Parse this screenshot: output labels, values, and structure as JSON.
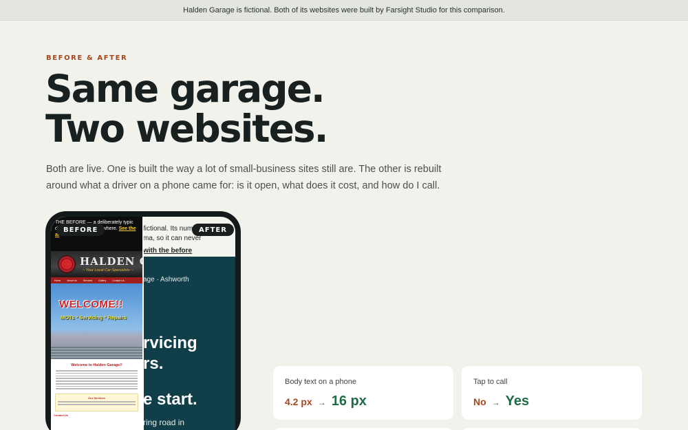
{
  "banner": "Halden Garage is fictional. Both of its websites were built by Farsight Studio for this comparison.",
  "eyebrow": "BEFORE & AFTER",
  "headline": {
    "line1": "Same garage.",
    "line2": "Two websites."
  },
  "lede": "Both are live. One is built the way a lot of small-business sites still are. The other is rebuilt around what a driver on a phone came for: is it open, what does it cost, and how do I call.",
  "phone": {
    "before_label": "BEFORE",
    "after_label": "AFTER",
    "after": {
      "line1": "fictional. Its num",
      "line2": "ma, so it can never",
      "link": "with the before",
      "location": "age · Ashworth",
      "heading1": "rvicing",
      "heading2": "rs.",
      "heading3": "e start.",
      "body": "ring road in"
    },
    "before": {
      "notice": "THE BEFORE — a deliberately typic den Garage is ficti anywhere.",
      "notice_link": "See the af",
      "logo_name": "HALDEN G",
      "logo_tag": "~ Your Local Car Specialists ~",
      "nav": [
        "Home",
        "About Us",
        "Services",
        "Gallery",
        "Contact Us"
      ],
      "welcome": "WELCOME!!",
      "services": "MOTs * Servicing * Repairs",
      "body_title": "Welcome to Halden Garage!!",
      "box_title": "Our Services",
      "contact": "Contact Us"
    }
  },
  "stats": [
    {
      "label": "Body text on a phone",
      "before": "4.2 px",
      "after": "16 px"
    },
    {
      "label": "Tap to call",
      "before": "No",
      "after": "Yes"
    }
  ],
  "arrow": "→",
  "colors": {
    "accent_rust": "#a3471e",
    "accent_green": "#1f6b45",
    "after_bg": "#103f4a"
  }
}
